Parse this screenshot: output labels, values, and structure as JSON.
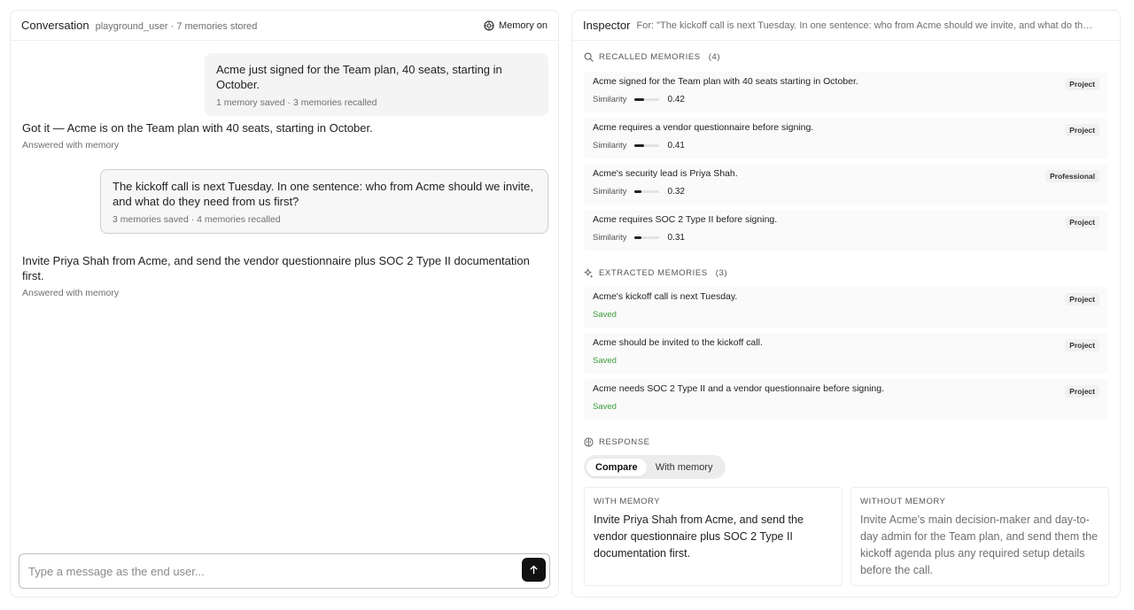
{
  "conversation": {
    "title": "Conversation",
    "subtitle": "playground_user · 7 memories stored",
    "memory_toggle": "Memory on",
    "messages": [
      {
        "role": "user",
        "text": "Acme just signed for the Team plan, 40 seats, starting in October.",
        "meta": "1 memory saved · 3 memories recalled"
      },
      {
        "role": "assistant",
        "text": "Got it — Acme is on the Team plan with 40 seats, starting in October.",
        "meta": "Answered with memory"
      },
      {
        "role": "user",
        "text": "The kickoff call is next Tuesday. In one sentence: who from Acme should we invite, and what do they need from us first?",
        "meta": "3 memories saved · 4 memories recalled"
      },
      {
        "role": "assistant",
        "text": "Invite Priya Shah from Acme, and send the vendor questionnaire plus SOC 2 Type II documentation first.",
        "meta": "Answered with memory"
      }
    ],
    "composer_placeholder": "Type a message as the end user..."
  },
  "inspector": {
    "title": "Inspector",
    "for_text": "For: \"The kickoff call is next Tuesday. In one sentence: who from Acme should we invite, and what do they nee...",
    "recalled": {
      "label": "Recalled memories",
      "count": "(4)",
      "similarity_label": "Similarity",
      "items": [
        {
          "text": "Acme signed for the Team plan with 40 seats starting in October.",
          "badge": "Project",
          "similarity": "0.42",
          "fill": 0.42
        },
        {
          "text": "Acme requires a vendor questionnaire before signing.",
          "badge": "Project",
          "similarity": "0.41",
          "fill": 0.41
        },
        {
          "text": "Acme's security lead is Priya Shah.",
          "badge": "Professional",
          "similarity": "0.32",
          "fill": 0.32
        },
        {
          "text": "Acme requires SOC 2 Type II before signing.",
          "badge": "Project",
          "similarity": "0.31",
          "fill": 0.31
        }
      ]
    },
    "extracted": {
      "label": "Extracted memories",
      "count": "(3)",
      "items": [
        {
          "text": "Acme's kickoff call is next Tuesday.",
          "badge": "Project",
          "status": "Saved"
        },
        {
          "text": "Acme should be invited to the kickoff call.",
          "badge": "Project",
          "status": "Saved"
        },
        {
          "text": "Acme needs SOC 2 Type II and a vendor questionnaire before signing.",
          "badge": "Project",
          "status": "Saved"
        }
      ]
    },
    "response": {
      "label": "Response",
      "tabs": [
        "Compare",
        "With memory"
      ],
      "with_label": "With memory",
      "with_text": "Invite Priya Shah from Acme, and send the vendor questionnaire plus SOC 2 Type II documentation first.",
      "without_label": "Without memory",
      "without_text": "Invite Acme's main decision-maker and day-to-day admin for the Team plan, and send them the kickoff agenda plus any required setup details before the call."
    }
  },
  "colors": {
    "saved": "#3a9a3a",
    "send_button": "#111111",
    "bar_fill": "#222222"
  }
}
